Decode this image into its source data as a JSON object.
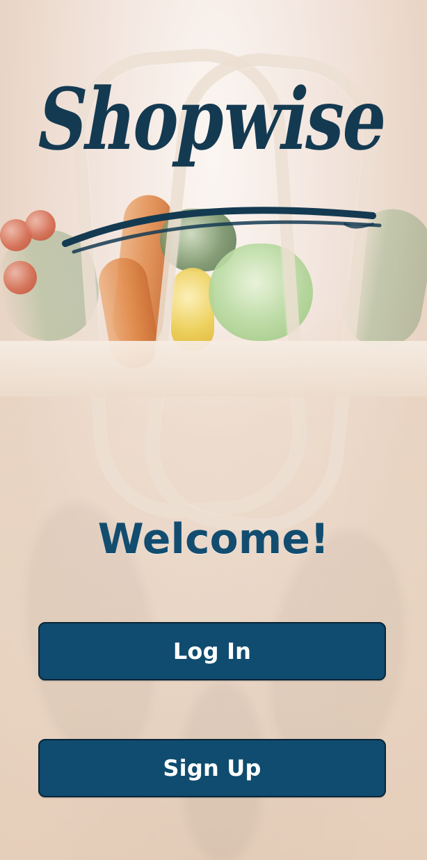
{
  "branding": {
    "app_name": "Shopwise",
    "logo_color": "#143a52"
  },
  "welcome": {
    "title": "Welcome!"
  },
  "actions": {
    "login_label": "Log In",
    "signup_label": "Sign Up"
  },
  "colors": {
    "primary": "#0f4c6f",
    "primary_border": "#0a2537",
    "welcome_text": "#124d70"
  },
  "background": {
    "theme": "grocery-bag-with-vegetables"
  }
}
